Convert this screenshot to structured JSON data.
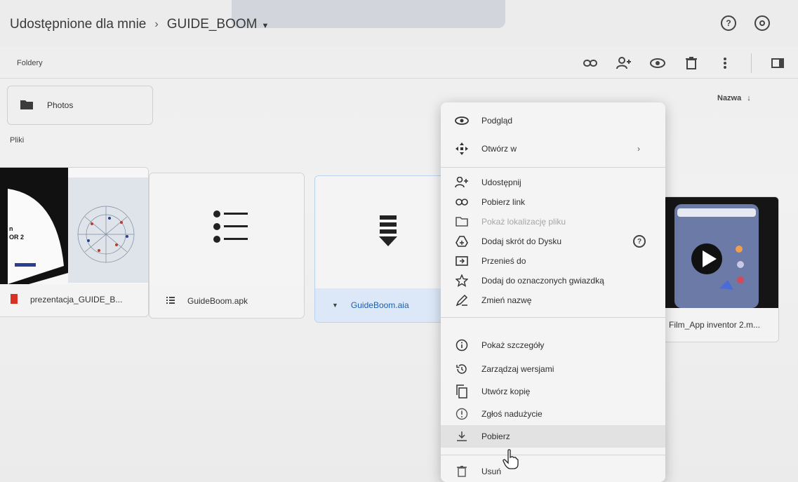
{
  "header": {
    "breadcrumb_root": "Udostępnione dla mnie",
    "breadcrumb_current": "GUIDE_BOOM",
    "help_icon": "help-icon",
    "settings_icon": "settings-icon"
  },
  "sections": {
    "folders": "Foldery",
    "files": "Pliki"
  },
  "sort": {
    "label": "Nazwa",
    "direction_icon": "arrow-down-icon"
  },
  "toolbar": {
    "icons": [
      "link-icon",
      "add-person-icon",
      "eye-icon",
      "trash-icon",
      "more-vert-icon",
      "details-panel-icon"
    ]
  },
  "folders": [
    {
      "name": "Photos",
      "icon": "folder-icon"
    }
  ],
  "files": [
    {
      "name": "prezentacja_GUIDE_B...",
      "icon": "pdf-icon",
      "thumb_text_1": "n",
      "thumb_text_2": "OR 2"
    },
    {
      "name": "GuideBoom.apk",
      "icon": "list-file-icon"
    },
    {
      "name": "GuideBoom.aia",
      "icon": "download-file-icon"
    },
    {
      "name": "Film_App inventor 2.m...",
      "icon": "video-icon"
    }
  ],
  "context_menu": {
    "items": [
      {
        "label": "Podgląd",
        "icon": "eye-icon"
      },
      {
        "label": "Otwórz w",
        "icon": "move-icon",
        "submenu": "›"
      },
      {
        "label": "Udostępnij",
        "icon": "add-person-icon"
      },
      {
        "label": "Pobierz link",
        "icon": "link-icon"
      },
      {
        "label": "Pokaż lokalizację pliku",
        "icon": "folder-outline-icon",
        "disabled": true
      },
      {
        "label": "Dodaj skrót do Dysku",
        "icon": "drive-shortcut-icon",
        "help": "?"
      },
      {
        "label": "Przenieś do",
        "icon": "move-to-icon"
      },
      {
        "label": "Dodaj do oznaczonych gwiazdką",
        "icon": "star-icon"
      },
      {
        "label": "Zmień nazwę",
        "icon": "pencil-icon"
      },
      {
        "label": "Pokaż szczegóły",
        "icon": "info-icon"
      },
      {
        "label": "Zarządzaj wersjami",
        "icon": "history-icon"
      },
      {
        "label": "Utwórz kopię",
        "icon": "copy-icon"
      },
      {
        "label": "Zgłoś nadużycie",
        "icon": "report-icon"
      },
      {
        "label": "Pobierz",
        "icon": "download-icon",
        "hovered": true
      },
      {
        "label": "Usuń",
        "icon": "trash-icon"
      }
    ]
  },
  "colors": {
    "background": "#ececec",
    "selected_file": "#dce8f7",
    "selected_text": "#1a5fb4"
  }
}
